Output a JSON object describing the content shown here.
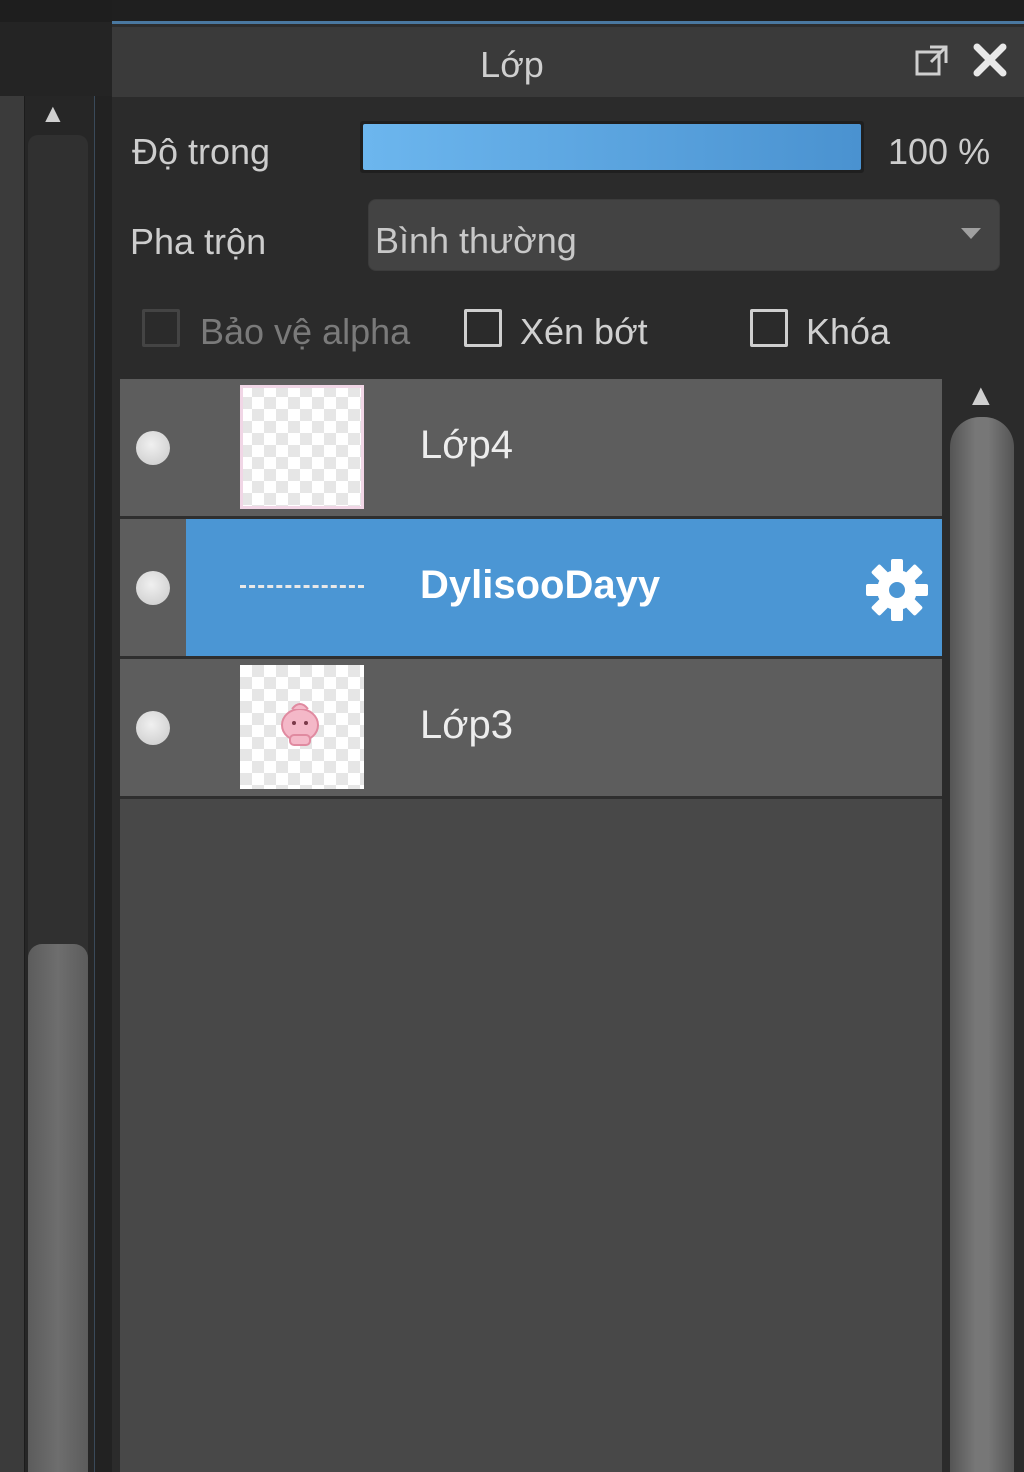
{
  "panel": {
    "title": "Lớp",
    "opacity": {
      "label": "Độ trong",
      "value_text": "100 %",
      "value_percent": 100
    },
    "blend": {
      "label": "Pha trộn",
      "value": "Bình thường"
    },
    "options": [
      {
        "label": "Bảo vệ alpha",
        "checked": false,
        "enabled": false
      },
      {
        "label": "Xén bớt",
        "checked": false,
        "enabled": true
      },
      {
        "label": "Khóa",
        "checked": false,
        "enabled": true
      }
    ],
    "layers": [
      {
        "name": "Lớp4",
        "visible": true,
        "selected": false,
        "thumbnail": "transparent"
      },
      {
        "name": "DylisooDayy",
        "visible": true,
        "selected": true,
        "thumbnail": "text-line"
      },
      {
        "name": "Lớp3",
        "visible": true,
        "selected": false,
        "thumbnail": "pink-character"
      }
    ]
  },
  "colors": {
    "accent": "#4b96d4",
    "opacity_fill": "#5aa6e2",
    "panel_bg": "#2b2b2b",
    "layer_row": "#5d5d5d"
  },
  "icons": [
    "popout-icon",
    "close-icon",
    "chevron-down-icon",
    "visibility-icon",
    "gear-icon",
    "scroll-up-icon"
  ]
}
